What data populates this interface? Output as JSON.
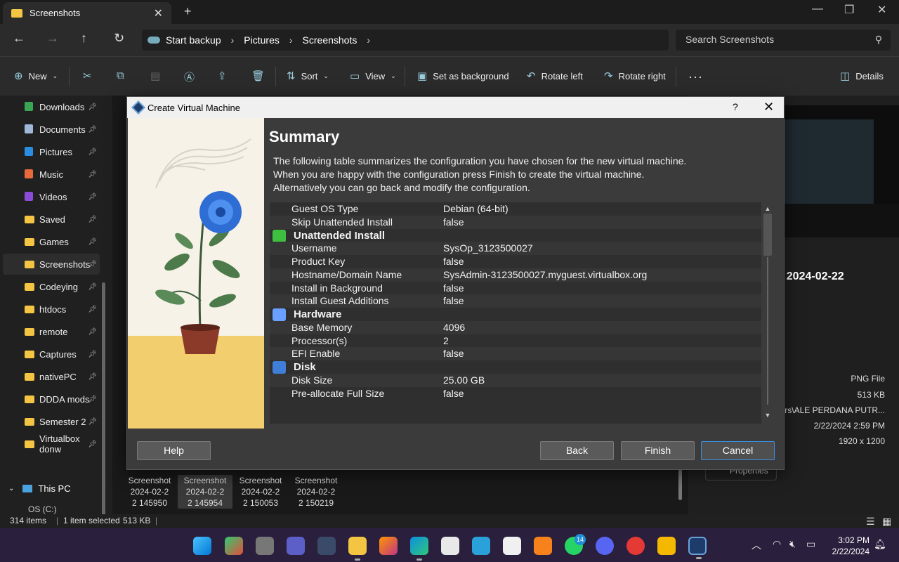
{
  "explorer": {
    "tab_title": "Screenshots",
    "breadcrumbs": [
      "Start backup",
      "Pictures",
      "Screenshots"
    ],
    "search_placeholder": "Search Screenshots",
    "toolbar": {
      "new": "New",
      "sort": "Sort",
      "view": "View",
      "set_background": "Set as background",
      "rotate_left": "Rotate left",
      "rotate_right": "Rotate right",
      "details": "Details"
    },
    "sidebar": [
      {
        "label": "Downloads"
      },
      {
        "label": "Documents"
      },
      {
        "label": "Pictures"
      },
      {
        "label": "Music"
      },
      {
        "label": "Videos"
      },
      {
        "label": "Saved"
      },
      {
        "label": "Games"
      },
      {
        "label": "Screenshots"
      },
      {
        "label": "Codeying"
      },
      {
        "label": "htdocs"
      },
      {
        "label": "remote"
      },
      {
        "label": "Captures"
      },
      {
        "label": "nativePC"
      },
      {
        "label": "DDDA mods"
      },
      {
        "label": "Semester 2"
      },
      {
        "label": "Virtualbox donw"
      }
    ],
    "this_pc": "This PC",
    "os_drive": "OS (C:)",
    "files": [
      {
        "line1": "Screenshot",
        "line2": "2024-02-2",
        "line3": "2 145950"
      },
      {
        "line1": "Screenshot",
        "line2": "2024-02-2",
        "line3": "2 145954"
      },
      {
        "line1": "Screenshot",
        "line2": "2024-02-2",
        "line3": "2 150053"
      },
      {
        "line1": "Screenshot",
        "line2": "2024-02-2",
        "line3": "2 150219"
      }
    ],
    "details_pane": {
      "title": "t 2024-02-22",
      "type": "PNG File",
      "size": "513 KB",
      "path": "sers\\ALE PERDANA PUTR...",
      "date": "2/22/2024 2:59 PM",
      "dims": "1920 x 1200",
      "properties": "Properties"
    },
    "status": {
      "items": "314 items",
      "selected": "1 item selected",
      "size": "513 KB"
    }
  },
  "dialog": {
    "title": "Create Virtual Machine",
    "help_glyph": "?",
    "heading": "Summary",
    "description": [
      "The following table summarizes the configuration you have chosen for the new virtual machine.",
      "When you are happy with the configuration press Finish to create the virtual machine.",
      "Alternatively you can go back and modify the configuration."
    ],
    "rows": [
      {
        "type": "row",
        "key": "Guest OS Type",
        "value": "Debian (64-bit)"
      },
      {
        "type": "row",
        "key": "Skip Unattended Install",
        "value": "false"
      },
      {
        "type": "group",
        "key": "Unattended Install",
        "icon": "unattended-icon"
      },
      {
        "type": "row",
        "key": "Username",
        "value": "SysOp_3123500027"
      },
      {
        "type": "row",
        "key": "Product Key",
        "value": "false"
      },
      {
        "type": "row",
        "key": "Hostname/Domain Name",
        "value": "SysAdmin-3123500027.myguest.virtualbox.org"
      },
      {
        "type": "row",
        "key": "Install in Background",
        "value": "false"
      },
      {
        "type": "row",
        "key": "Install Guest Additions",
        "value": "false"
      },
      {
        "type": "group",
        "key": "Hardware",
        "icon": "hardware-icon"
      },
      {
        "type": "row",
        "key": "Base Memory",
        "value": "4096"
      },
      {
        "type": "row",
        "key": "Processor(s)",
        "value": "2"
      },
      {
        "type": "row",
        "key": "EFI Enable",
        "value": "false"
      },
      {
        "type": "group",
        "key": "Disk",
        "icon": "disk-icon"
      },
      {
        "type": "row",
        "key": "Disk Size",
        "value": "25.00 GB"
      },
      {
        "type": "row",
        "key": "Pre-allocate Full Size",
        "value": "false"
      }
    ],
    "buttons": {
      "help": "Help",
      "back": "Back",
      "finish": "Finish",
      "cancel": "Cancel"
    }
  },
  "taskbar": {
    "whatsapp_badge": "14",
    "time": "3:02 PM",
    "date": "2/22/2024"
  },
  "colors": {
    "dialog_bg": "#3b3b3b",
    "taskbar_bg": "#2a1f3d",
    "folder_yellow": "#f4c542",
    "accent_blue": "#3e8ede"
  }
}
